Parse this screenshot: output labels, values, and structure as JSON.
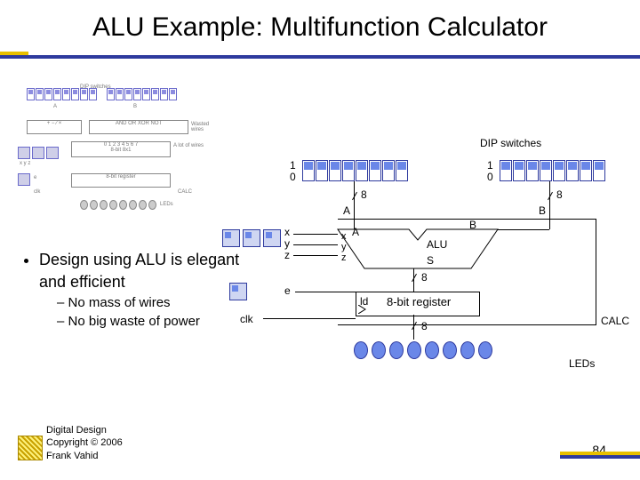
{
  "title": "ALU Example: Multifunction Calculator",
  "bullet_main": "Design using ALU is elegant and efficient",
  "bullet_sub1": "No mass of wires",
  "bullet_sub2": "No big waste of power",
  "diagram": {
    "dip_label": "DIP switches",
    "leds_label": "LEDs",
    "one_a": "1",
    "zero_a": "0",
    "one_b": "1",
    "zero_b": "0",
    "bus_a1": "8",
    "bus_b1": "8",
    "A_top": "A",
    "B_top": "B",
    "A_in": "A",
    "B_in": "B",
    "x": "x",
    "y": "y",
    "z": "z",
    "x_in": "x",
    "y_in": "y",
    "z_in": "z",
    "ALU": "ALU",
    "S": "S",
    "bus_s": "8",
    "e": "e",
    "ld": "ld",
    "reg": "8-bit register",
    "clk": "clk",
    "bus_out": "8",
    "calc": "CALC"
  },
  "footer": {
    "line1": "Digital Design",
    "line2": "Copyright © 2006",
    "line3": "Frank Vahid"
  },
  "page": "84"
}
